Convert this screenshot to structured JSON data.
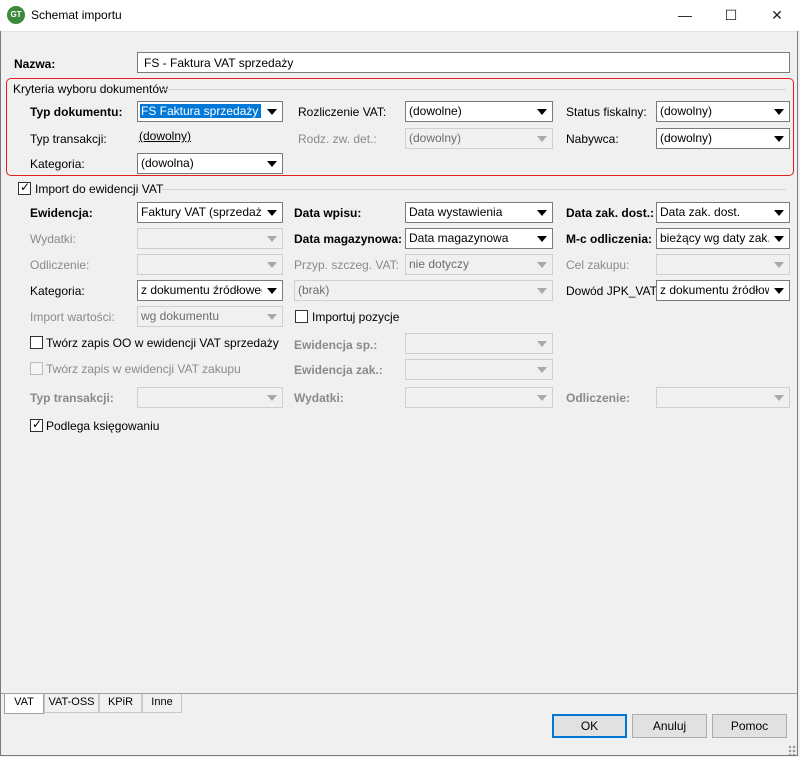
{
  "window": {
    "title": "Schemat importu",
    "icon_text": "GT",
    "minimize": "—",
    "maximize": "☐",
    "close": "✕"
  },
  "nazwa": {
    "label": "Nazwa:",
    "value": "FS - Faktura VAT sprzedaży"
  },
  "kryteria": {
    "title": "Kryteria wyboru dokumentów",
    "typ_dok_label": "Typ dokumentu:",
    "typ_dok_value": "FS Faktura sprzedaży",
    "rozliczenie_label": "Rozliczenie VAT:",
    "rozliczenie_value": "(dowolne)",
    "status_label": "Status fiskalny:",
    "status_value": "(dowolny)",
    "typ_trans_label": "Typ transakcji:",
    "typ_trans_value": "(dowolny)",
    "rodz_label": "Rodz. zw. det.:",
    "rodz_value": "(dowolny)",
    "nabywca_label": "Nabywca:",
    "nabywca_value": "(dowolny)",
    "kategoria_label": "Kategoria:",
    "kategoria_value": "(dowolna)"
  },
  "import_vat": {
    "checkbox_label": "Import do ewidencji VAT",
    "ewidencja_label": "Ewidencja:",
    "ewidencja_value": "Faktury VAT (sprzedaż)",
    "data_wpisu_label": "Data wpisu:",
    "data_wpisu_value": "Data wystawienia",
    "data_zak_label": "Data zak. dost.:",
    "data_zak_value": "Data zak. dost.",
    "wydatki_label": "Wydatki:",
    "wydatki_value": "",
    "data_mag_label": "Data magazynowa:",
    "data_mag_value": "Data magazynowa",
    "mc_label": "M-c odliczenia:",
    "mc_value": "bieżący wg daty zak. do",
    "odliczenie_label": "Odliczenie:",
    "odliczenie_value": "",
    "przyp_label": "Przyp. szczeg. VAT:",
    "przyp_value": "nie dotyczy",
    "cel_label": "Cel zakupu:",
    "cel_value": "",
    "kategoria_label": "Kategoria:",
    "kategoria_value": "z dokumentu źródłowego",
    "brak_value": "(brak)",
    "dowod_label": "Dowód JPK_VAT:",
    "dowod_value": "z dokumentu źródłowego",
    "import_wart_label": "Import wartości:",
    "import_wart_value": "wg dokumentu",
    "importuj_poz_label": "Importuj pozycje",
    "tworz_oo_label": "Twórz zapis OO w ewidencji VAT sprzedaży",
    "ewid_sp_label": "Ewidencja sp.:",
    "ewid_sp_value": "",
    "tworz_zak_label": "Twórz zapis w ewidencji VAT zakupu",
    "ewid_zak_label": "Ewidencja zak.:",
    "ewid_zak_value": "",
    "typ_trans_label": "Typ transakcji:",
    "typ_trans_value": "",
    "wydatki2_label": "Wydatki:",
    "wydatki2_value": "",
    "odliczenie2_label": "Odliczenie:",
    "odliczenie2_value": "",
    "podlega_label": "Podlega księgowaniu"
  },
  "tabs": [
    "VAT",
    "VAT-OSS",
    "KPiR",
    "Inne"
  ],
  "buttons": {
    "ok": "OK",
    "cancel": "Anuluj",
    "help": "Pomoc"
  },
  "colors": {
    "selection": "#0078d7",
    "highlight_border": "#e02020",
    "background": "#f0f0f0"
  }
}
